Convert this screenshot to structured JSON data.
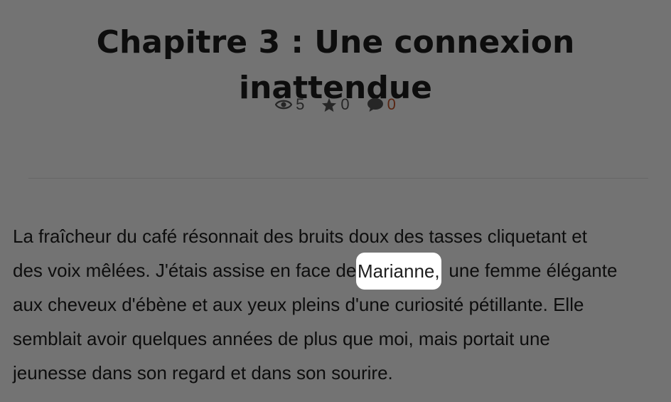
{
  "chapter": {
    "title": "Chapitre 3 : Une connexion inattendue"
  },
  "stats": {
    "views_icon": "eye-icon",
    "views": "5",
    "stars_icon": "star-icon",
    "stars": "0",
    "comments_icon": "comment-icon",
    "comments": "0",
    "comment_color": "#c4562b"
  },
  "content": {
    "lines": [
      "La fraîcheur du café résonnait des bruits doux des tasses cliquetant et",
      "des voix mêlées. J'étais assise en face de ",
      "aux cheveux d'ébène et aux yeux pleins d'une curiosité pétillante. Elle",
      "semblait avoir quelques années de plus que moi, mais portait une",
      "jeunesse dans son regard et dans son sourire."
    ],
    "highlight_word": "Marianne,",
    "line2_tail": " une femme élégante"
  }
}
